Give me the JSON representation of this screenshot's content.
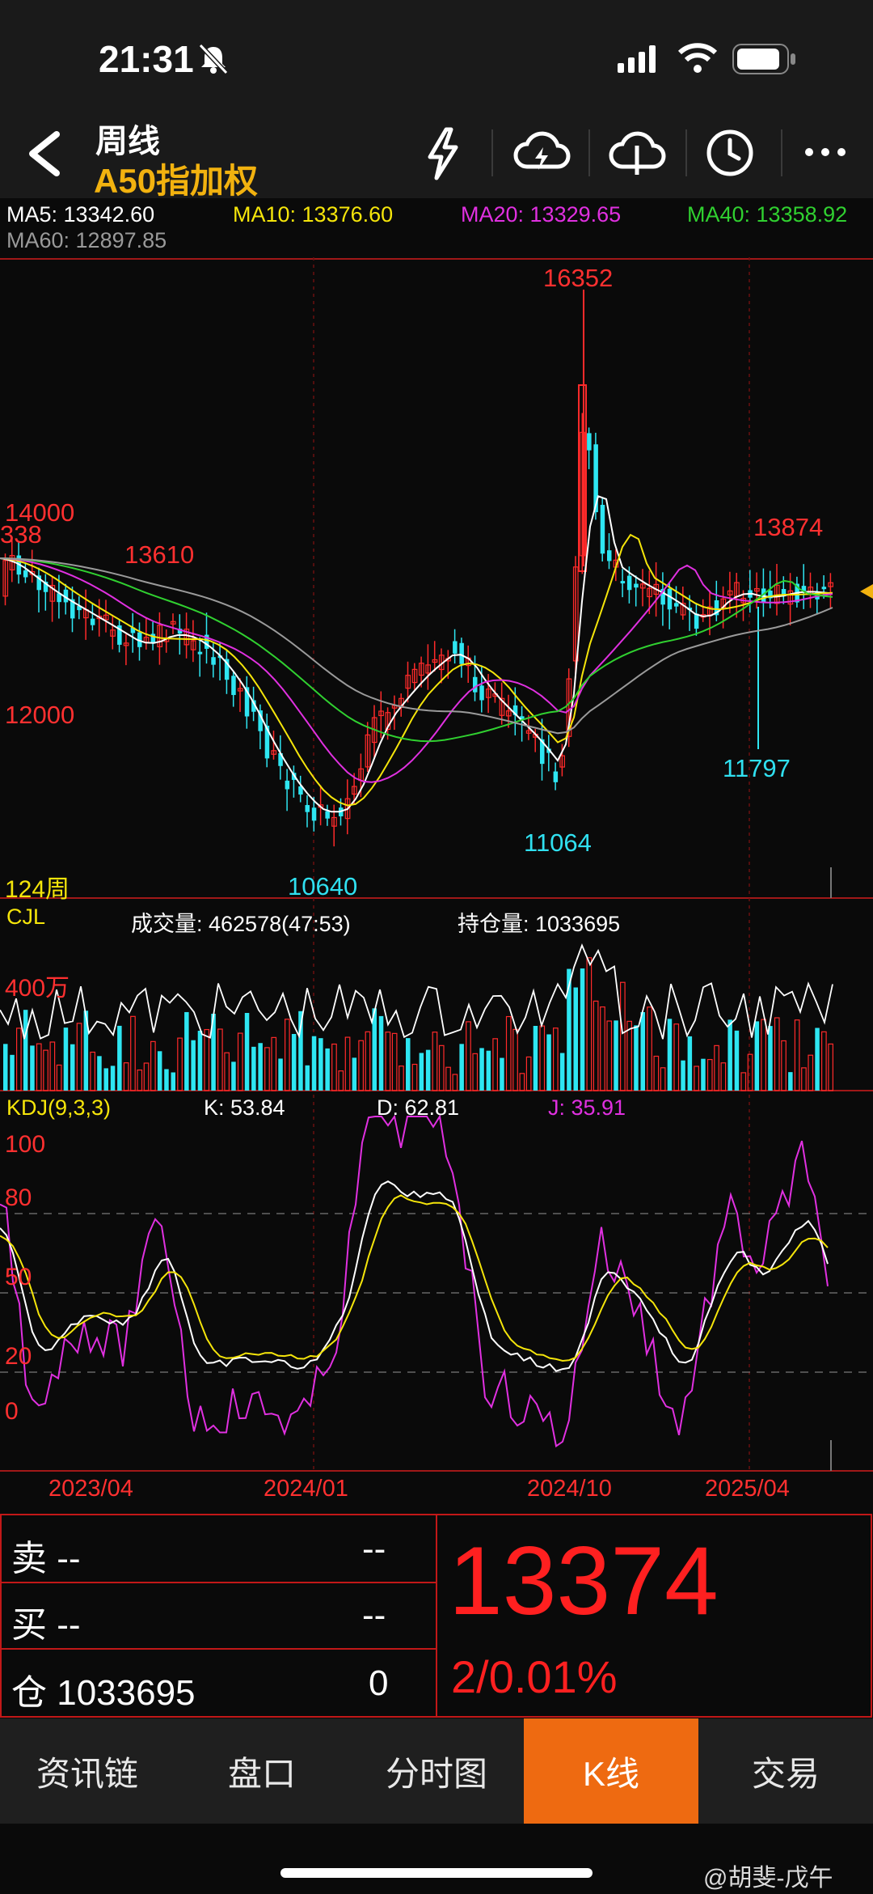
{
  "status_bar": {
    "time": "21:31",
    "mute_icon": "bell-slash-icon"
  },
  "header": {
    "period": "周线",
    "instrument": "A50指加权",
    "icons": [
      "back-chevron-icon",
      "lightning-icon",
      "cloud-lightning-icon",
      "cloud-split-icon",
      "clock-icon",
      "more-icon"
    ]
  },
  "ma_line": {
    "ma5": "MA5: 13342.60",
    "ma10": "MA10: 13376.60",
    "ma20": "MA20: 13329.65",
    "ma40": "MA40: 13358.92",
    "ma60": "MA60: 12897.85",
    "colors": {
      "ma5": "#ffffff",
      "ma10": "#f5e50a",
      "ma20": "#e030e0",
      "ma40": "#30d030",
      "ma60": "#9a9a9a"
    }
  },
  "price_chart": {
    "y_labels": [
      "14000",
      "12000"
    ],
    "clipped_label": "338",
    "period_count": "124周",
    "annotations": {
      "high": "16352",
      "left_high": "13610",
      "right_high": "13874",
      "low1": "10640",
      "low2": "11064",
      "low3": "11797"
    }
  },
  "volume": {
    "label": "CJL",
    "volume_text": "成交量: 462578(47:53)",
    "oi_text": "持仓量: 1033695",
    "scale_label": "400万"
  },
  "kdj": {
    "label": "KDJ(9,3,3)",
    "k": "K: 53.84",
    "d": "D: 62.81",
    "j": "J: 35.91",
    "y_labels": [
      "100",
      "80",
      "50",
      "20",
      "0"
    ]
  },
  "x_axis": [
    "2023/04",
    "2024/01",
    "2024/10",
    "2025/04"
  ],
  "quote": {
    "sell_label": "卖 --",
    "sell_value": "--",
    "buy_label": "买 --",
    "buy_value": "--",
    "oi_label": "仓 1033695",
    "oi_value": "0",
    "price": "13374",
    "change": "2/0.01%"
  },
  "tabs": [
    "资讯链",
    "盘口",
    "分时图",
    "K线",
    "交易"
  ],
  "active_tab": "K线",
  "watermark": "@胡斐-戊午"
}
